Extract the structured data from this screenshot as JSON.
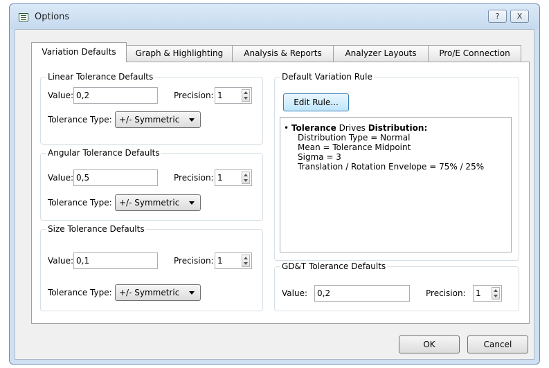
{
  "window": {
    "title": "Options",
    "help_label": "?",
    "close_label": "X"
  },
  "tabs": [
    {
      "label": "Variation Defaults",
      "active": true
    },
    {
      "label": "Graph & Highlighting",
      "active": false
    },
    {
      "label": "Analysis & Reports",
      "active": false
    },
    {
      "label": "Analyzer Layouts",
      "active": false
    },
    {
      "label": "Pro/E Connection",
      "active": false
    }
  ],
  "linear": {
    "title": "Linear Tolerance Defaults",
    "value_label": "Value:",
    "value": "0,2",
    "precision_label": "Precision:",
    "precision": "1",
    "type_label": "Tolerance Type:",
    "type": "+/- Symmetric"
  },
  "angular": {
    "title": "Angular Tolerance Defaults",
    "value_label": "Value:",
    "value": "0,5",
    "precision_label": "Precision:",
    "precision": "1",
    "type_label": "Tolerance Type:",
    "type": "+/- Symmetric"
  },
  "size": {
    "title": "Size Tolerance Defaults",
    "value_label": "Value:",
    "value": "0,1",
    "precision_label": "Precision:",
    "precision": "1",
    "type_label": "Tolerance Type:",
    "type": "+/- Symmetric"
  },
  "rule": {
    "title": "Default Variation Rule",
    "edit_button": "Edit Rule...",
    "bullet": "•",
    "head_bold1": "Tolerance",
    "head_mid": " Drives ",
    "head_bold2": "Distribution:",
    "lines": [
      "Distribution Type = Normal",
      "Mean = Tolerance Midpoint",
      "Sigma = 3",
      "Translation / Rotation Envelope = 75% / 25%"
    ]
  },
  "gdt": {
    "title": "GD&T Tolerance Defaults",
    "value_label": "Value:",
    "value": "0,2",
    "precision_label": "Precision:",
    "precision": "1"
  },
  "footer": {
    "ok": "OK",
    "cancel": "Cancel"
  }
}
